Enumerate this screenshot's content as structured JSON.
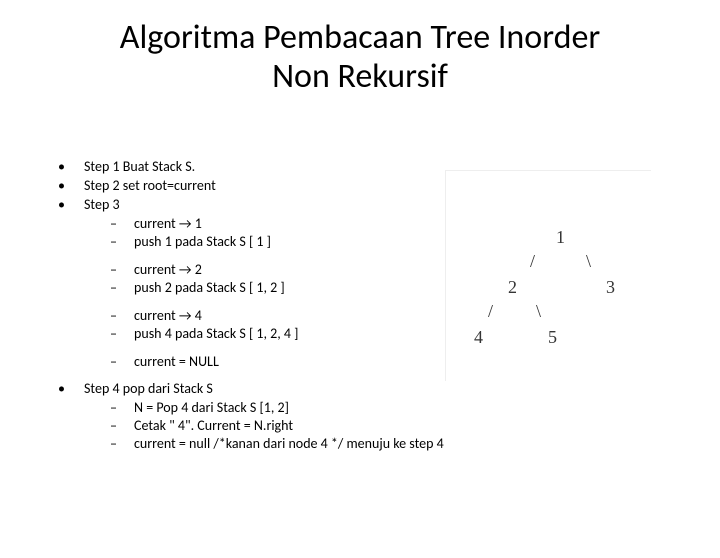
{
  "title_line1": "Algoritma Pembacaan Tree Inorder",
  "title_line2": "Non Rekursif",
  "bullets": {
    "b1": "Step 1 Buat Stack S.",
    "b2": "Step 2 set root=current",
    "b3": "Step 3",
    "b4": "Step 4 pop dari Stack S"
  },
  "sub3": {
    "g1a": "current  → 1",
    "g1b": "push 1 pada Stack S [ 1 ]",
    "g2a": "current  → 2",
    "g2b": "push 2 pada Stack S [ 1, 2 ]",
    "g3a": "current  → 4",
    "g3b": "push 4 pada Stack S [ 1, 2, 4 ]",
    "g4a": "current = NULL"
  },
  "sub4": {
    "a": "N = Pop 4 dari Stack S [1, 2]",
    "b": "Cetak \" 4\". Current = N.right",
    "c": "current = null /*kanan dari node 4 */ menuju ke step 4"
  },
  "tree": {
    "n1": "1",
    "n2": "2",
    "n3": "3",
    "n4": "4",
    "n5": "5",
    "sl": "/",
    "sr": "\\"
  }
}
